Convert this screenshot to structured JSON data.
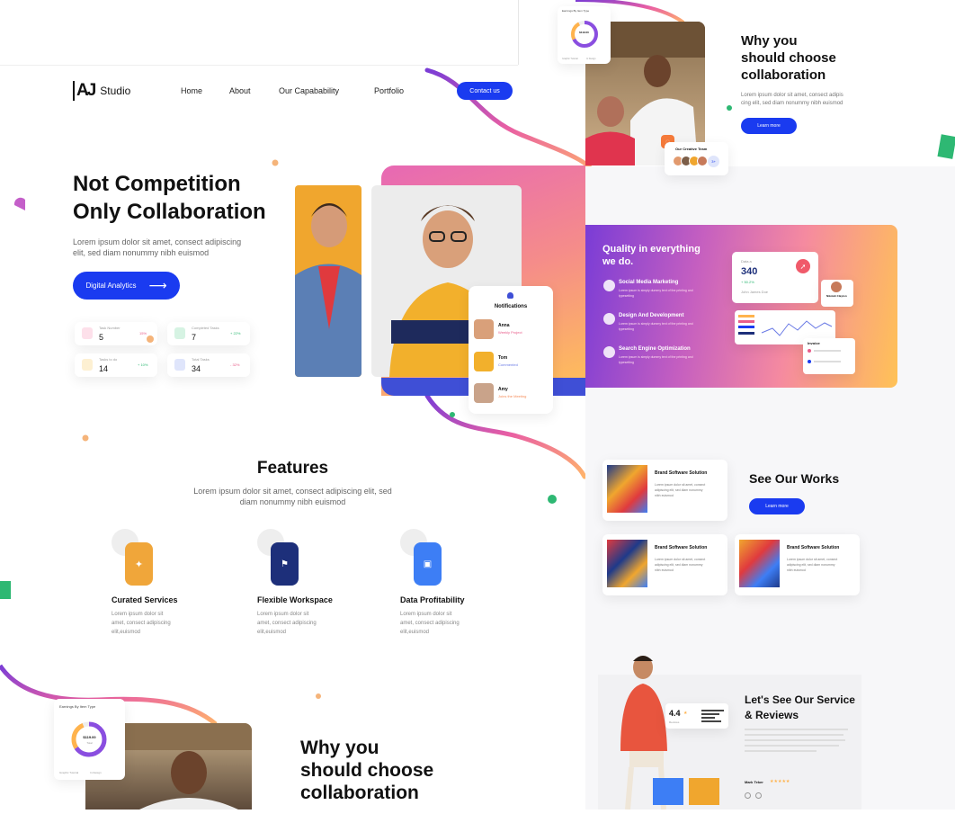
{
  "logo": {
    "mark": "AJ",
    "text": "Studio"
  },
  "nav": {
    "items": [
      "Home",
      "About",
      "Our Capabability",
      "Portfolio"
    ],
    "contact": "Contact us"
  },
  "hero": {
    "title_line1": "Not Competition",
    "title_line2": "Only Collaboration",
    "desc_line1": "Lorem ipsum dolor sit amet, consect adipiscing",
    "desc_line2": "elit, sed diam nonummy nibh euismod",
    "cta": "Digital Analytics"
  },
  "stats": [
    {
      "label": "Task Number",
      "value": "5",
      "change": "15%",
      "color": "#e85d8a"
    },
    {
      "label": "Completed Tasks",
      "value": "7",
      "change": "+ 22%",
      "color": "#2eb873"
    },
    {
      "label": "Tasks to do",
      "value": "14",
      "change": "+ 10%",
      "color": "#2eb873"
    },
    {
      "label": "Total Tasks",
      "value": "34",
      "change": "- 32%",
      "color": "#e85d8a"
    }
  ],
  "notifications": {
    "title": "Notifications",
    "items": [
      {
        "name": "Anna",
        "status": "Weekly Project"
      },
      {
        "name": "Tom",
        "status": "Commented"
      },
      {
        "name": "Amy",
        "status": "Joins the Meeting"
      }
    ]
  },
  "features": {
    "title": "Features",
    "desc_line1": "Lorem ipsum dolor sit amet, consect adipiscing elit, sed",
    "desc_line2": "diam nonummy nibh euismod",
    "items": [
      {
        "title": "Curated Services",
        "l1": "Lorem ipsum dolor sit",
        "l2": "amet, consect adipiscing",
        "l3": "elit,euismod",
        "color": "#f0a63a"
      },
      {
        "title": "Flexible Workspace",
        "l1": "Lorem ipsum dolor sit",
        "l2": "amet, consect adipiscing",
        "l3": "elit,euismod",
        "color": "#1d2f7a"
      },
      {
        "title": "Data Profitability",
        "l1": "Lorem ipsum dolor sit",
        "l2": "amet, consect adipiscing",
        "l3": "elit,euismod",
        "color": "#3d7ef5"
      }
    ]
  },
  "why": {
    "line1": "Why you",
    "line2": "should choose",
    "line3": "collaboration",
    "desc_line1": "Lorem ipsum dolor sit amet, consect adipis",
    "desc_line2": "cing elit, sed diam nonummy nibh euismod",
    "cta": "Learn more",
    "team_label": "Our Creative Team",
    "team_more": "3+"
  },
  "earnings": {
    "title": "Earnings By Item Type",
    "value": "$119.00",
    "sub": "Total",
    "legend1": "Graphic Tutorial",
    "legend2": "In Design"
  },
  "quality": {
    "title_line1": "Quality in everything",
    "title_line2": "we do.",
    "items": [
      {
        "title": "Social Media Marketing",
        "l1": "Lorem ipsum is simply dummy text of the printing and",
        "l2": "typesetting"
      },
      {
        "title": "Design And Development",
        "l1": "Lorem ipsum is simply dummy text of the printing and",
        "l2": "typesetting"
      },
      {
        "title": "Search Engine Optimization",
        "l1": "Lorem ipsum is simply dummy text of the printing and",
        "l2": "typesetting"
      }
    ],
    "data_label": "Data a",
    "data_value": "340",
    "data_change": "+ 50.2%",
    "data_name": "John James Doe",
    "person_name": "Nikolah Clayton",
    "invoice_label": "Invoice"
  },
  "works": {
    "title": "See Our Works",
    "cta": "Learn more",
    "cards": [
      {
        "title": "Brand Software Solution",
        "l1": "Lorem ipsum dolor sit amet, consect",
        "l2": "adipiscing elit, sed diam nonummy",
        "l3": "nibh euismod"
      },
      {
        "title": "Brand Software Solution",
        "l1": "Lorem ipsum dolor sit amet, consect",
        "l2": "adipiscing elit, sed diam nonummy",
        "l3": "nibh euismod"
      },
      {
        "title": "Brand Software Solution",
        "l1": "Lorem ipsum dolor sit amet, consect",
        "l2": "adipiscing elit, sed diam nonummy",
        "l3": "nibh euismod"
      }
    ]
  },
  "reviews": {
    "title_line1": "Let's See Our Service",
    "title_line2": "& Reviews",
    "rating": "4.4",
    "rating_star": "★",
    "rating_sub": "Reviews",
    "reviewer": "Mark Teker",
    "stars": "★★★★★"
  },
  "colors": {
    "primary": "#1a3bf0",
    "gradient_start": "#7a3cd6",
    "gradient_mid": "#e95fa3",
    "gradient_end": "#ffc34d"
  }
}
